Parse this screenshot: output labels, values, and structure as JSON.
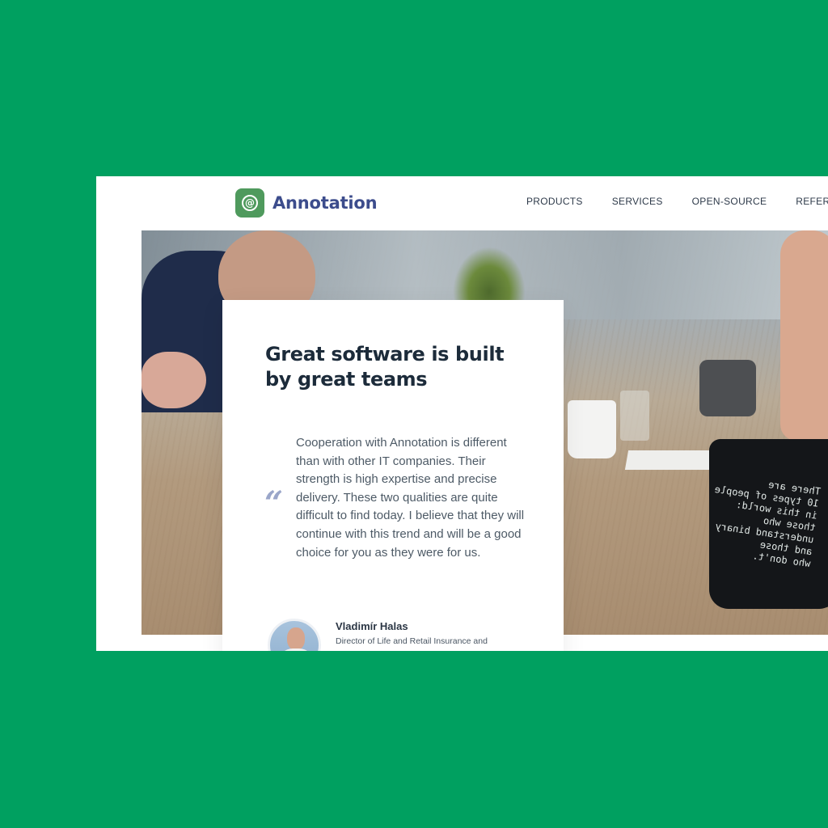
{
  "brand": {
    "icon": "at-sign-icon",
    "icon_glyph": "@",
    "name": "Annotation",
    "color": "#3c4c8c",
    "mark_color": "#4f9a5d"
  },
  "nav": {
    "items": [
      {
        "label": "PRODUCTS"
      },
      {
        "label": "SERVICES"
      },
      {
        "label": "OPEN-SOURCE"
      },
      {
        "label": "REFERENC"
      }
    ]
  },
  "hero": {
    "mug_text": "There are\n10 types of people\nin this world:\nthose who\nunderstand binary\nand those\nwho don't."
  },
  "testimonial": {
    "title": "Great software is built by great teams",
    "quote_glyph": "“",
    "quote": "Cooperation with Annotation is different than with other IT companies. Their strength is high expertise and precise delivery. These two qualities are quite difficult to find today. I believe that they will continue with this trend and will be a good choice for you as they were for us.",
    "author_name": "Vladimír Halas",
    "author_role": "Director of Life and Retail Insurance and"
  },
  "colors": {
    "background": "#00a060",
    "heading": "#1c2b3a",
    "body_text": "#4d5a66",
    "quote_mark": "#9aa6c9"
  }
}
